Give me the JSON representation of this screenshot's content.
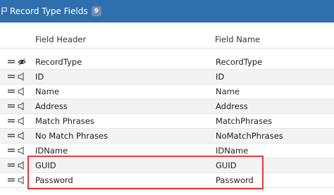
{
  "header": {
    "title": "Record Type Fields",
    "count": "9"
  },
  "columns": {
    "field_header": "Field Header",
    "field_name": "Field Name"
  },
  "rows": [
    {
      "header": "RecordType",
      "name": "RecordType",
      "icon": "eye-icon"
    },
    {
      "header": "ID",
      "name": "ID",
      "icon": "speaker-icon"
    },
    {
      "header": "Name",
      "name": "Name",
      "icon": "speaker-icon"
    },
    {
      "header": "Address",
      "name": "Address",
      "icon": "speaker-icon"
    },
    {
      "header": "Match Phrases",
      "name": "MatchPhrases",
      "icon": "speaker-icon"
    },
    {
      "header": "No Match Phrases",
      "name": "NoMatchPhrases",
      "icon": "speaker-icon"
    },
    {
      "header": "IDName",
      "name": "IDName",
      "icon": "speaker-icon"
    },
    {
      "header": "GUID",
      "name": "GUID",
      "icon": "speaker-icon"
    },
    {
      "header": "Password",
      "name": "Password",
      "icon": "speaker-icon"
    }
  ],
  "colors": {
    "header_bg": "#2f6fae",
    "highlight": "#e0393c"
  }
}
